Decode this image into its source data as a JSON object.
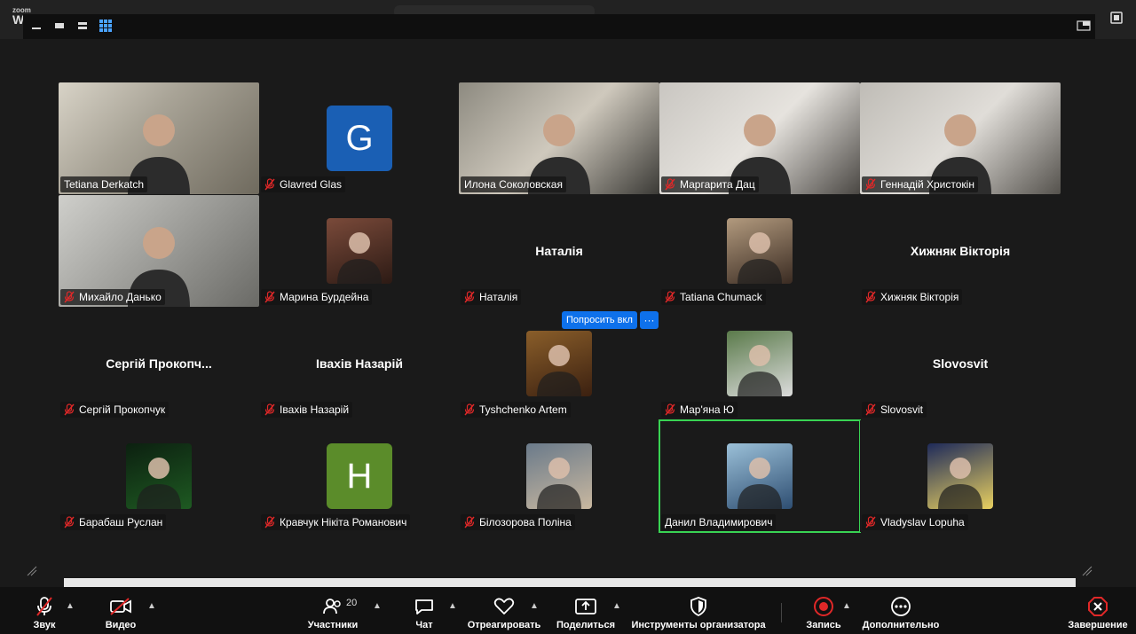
{
  "app": {
    "logo": "zoom",
    "window_letter": "W"
  },
  "tiles": [
    {
      "name": "Tetiana Derkatch",
      "type": "video",
      "muted": false
    },
    {
      "name": "Glavred Glas",
      "type": "letter",
      "letter": "G",
      "color": "#1a5fb4",
      "muted": true
    },
    {
      "name": "Илона Соколовская",
      "type": "video",
      "muted": false
    },
    {
      "name": "Маргарита Дац",
      "type": "video",
      "muted": true
    },
    {
      "name": "Геннадій Христокін",
      "type": "video",
      "muted": true
    },
    {
      "name": "Михайло Данько",
      "type": "video",
      "muted": true
    },
    {
      "name": "Марина Бурдейна",
      "type": "avatar",
      "muted": true
    },
    {
      "name": "Наталія",
      "type": "bigname",
      "display": "Наталія",
      "muted": true
    },
    {
      "name": "Tatiana Chumack",
      "type": "avatar",
      "muted": true
    },
    {
      "name": "Хижняк Вікторія",
      "type": "bigname",
      "display": "Хижняк Вікторія",
      "muted": true
    },
    {
      "name": "Сергій Прокопчук",
      "type": "bigname",
      "display": "Сергій  Прокопч...",
      "muted": true
    },
    {
      "name": "Іваxів Назарій",
      "type": "bigname",
      "display": "Іваxів Назарій",
      "muted": true
    },
    {
      "name": "Tyshchenko Artem",
      "type": "avatar",
      "muted": true
    },
    {
      "name": "Мар'яна Ю",
      "type": "avatar",
      "muted": true
    },
    {
      "name": "Slovosvit",
      "type": "bigname",
      "display": "Slovosvit",
      "muted": true
    },
    {
      "name": "Барабаш Руслан",
      "type": "avatar",
      "muted": true
    },
    {
      "name": "Кравчук Нікіта  Романович",
      "type": "letter",
      "letter": "H",
      "color": "#5b8c2a",
      "muted": true
    },
    {
      "name": "Білозорова Поліна",
      "type": "avatar",
      "muted": true
    },
    {
      "name": "Данил Владимирович",
      "type": "avatar",
      "muted": false,
      "active": true
    },
    {
      "name": "Vladyslav Lopuha",
      "type": "avatar",
      "muted": true
    }
  ],
  "request": {
    "label": "Попросить вкл",
    "more": "···"
  },
  "toolbar": {
    "audio": "Звук",
    "video": "Видео",
    "participants": "Участники",
    "participants_count": "20",
    "chat": "Чат",
    "react": "Отреагировать",
    "share": "Поделиться",
    "host_tools": "Инструменты организатора",
    "record": "Запись",
    "more": "Дополнительно",
    "end": "Завершение"
  },
  "colors": {
    "active_border": "#39d353",
    "accent": "#0e71eb",
    "record": "#e02828",
    "end": "#e02828"
  }
}
